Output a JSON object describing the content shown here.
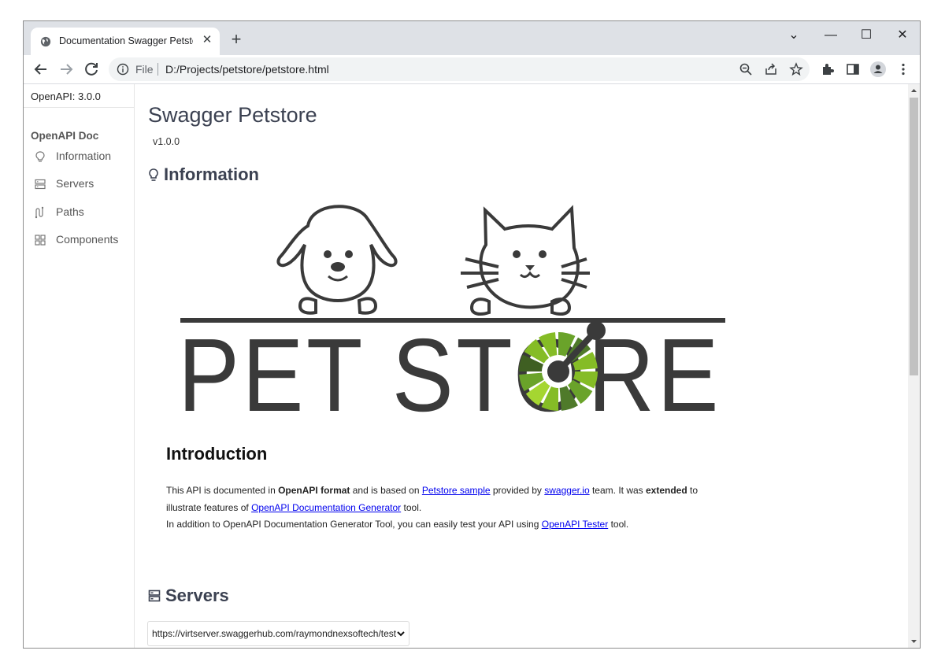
{
  "browser": {
    "tab_title": "Documentation Swagger Petstore",
    "tab_close": "✕",
    "new_tab": "+",
    "window_controls": {
      "chevron": "⌄",
      "minimize": "—",
      "maximize": "☐",
      "close": "✕"
    },
    "address": {
      "scheme_label": "File",
      "url": "D:/Projects/petstore/petstore.html"
    },
    "icons": [
      "back-icon",
      "forward-icon",
      "reload-icon",
      "info-icon",
      "zoom-icon",
      "share-icon",
      "star-icon",
      "extensions-icon",
      "side-panel-icon",
      "profile-icon",
      "menu-icon"
    ]
  },
  "sidebar": {
    "version": "OpenAPI: 3.0.0",
    "heading": "OpenAPI Doc",
    "items": [
      {
        "label": "Information",
        "icon": "lightbulb-icon"
      },
      {
        "label": "Servers",
        "icon": "server-icon"
      },
      {
        "label": "Paths",
        "icon": "paths-icon"
      },
      {
        "label": "Components",
        "icon": "components-icon"
      }
    ]
  },
  "main": {
    "title": "Swagger Petstore",
    "version": "v1.0.0",
    "information_heading": "Information",
    "logo_text": "PET STORE",
    "introduction": {
      "heading": "Introduction",
      "t1": "This API is documented in ",
      "b1": "OpenAPI format",
      "t2": " and is based on ",
      "link1": "Petstore sample",
      "t3": " provided by ",
      "link2": "swagger.io",
      "t4": " team. It was ",
      "b2": "extended",
      "t5": " to illustrate features of ",
      "link3": "OpenAPI Documentation Generator",
      "t6": " tool.",
      "t7": "In addition to OpenAPI Documentation Generator Tool, you can easily test your API using ",
      "link4": "OpenAPI Tester",
      "t8": " tool."
    },
    "servers_heading": "Servers",
    "server_url": "https://virtserver.swaggerhub.com/raymondnexsoftech/test"
  },
  "colors": {
    "accent_green": "#85bc26",
    "logo_dark": "#3a3a3a",
    "link": "#0000ee"
  }
}
